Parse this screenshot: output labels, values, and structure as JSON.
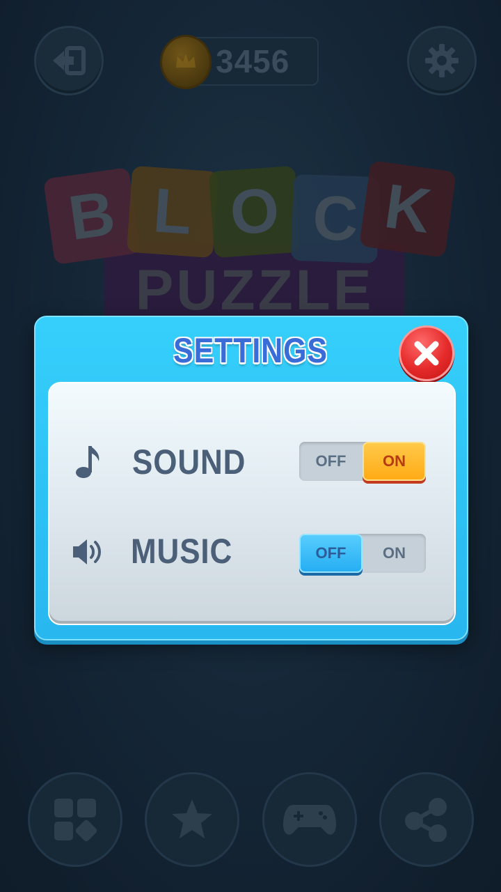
{
  "background": {
    "coins": "3456",
    "logo_letters": [
      "B",
      "L",
      "O",
      "C",
      "K"
    ],
    "logo_subtitle": "PUZZLE",
    "top_buttons": {
      "left_icon": "exit-icon",
      "right_icon": "gear-icon"
    },
    "bottom_buttons": [
      "grid-icon",
      "star-icon",
      "gamepad-icon",
      "share-icon"
    ]
  },
  "settings": {
    "title": "SETTINGS",
    "close_icon": "close-icon",
    "rows": [
      {
        "label": "SOUND",
        "icon": "music-note-icon",
        "off_label": "OFF",
        "on_label": "ON",
        "state": "ON"
      },
      {
        "label": "MUSIC",
        "icon": "speaker-icon",
        "off_label": "OFF",
        "on_label": "ON",
        "state": "OFF"
      }
    ]
  },
  "colors": {
    "modal_blue": "#2fc6f8",
    "title_blue": "#3a6cd8",
    "toggle_on_orange": "#ffab16",
    "toggle_off_blue": "#26aef3",
    "close_red": "#e52a2a"
  }
}
